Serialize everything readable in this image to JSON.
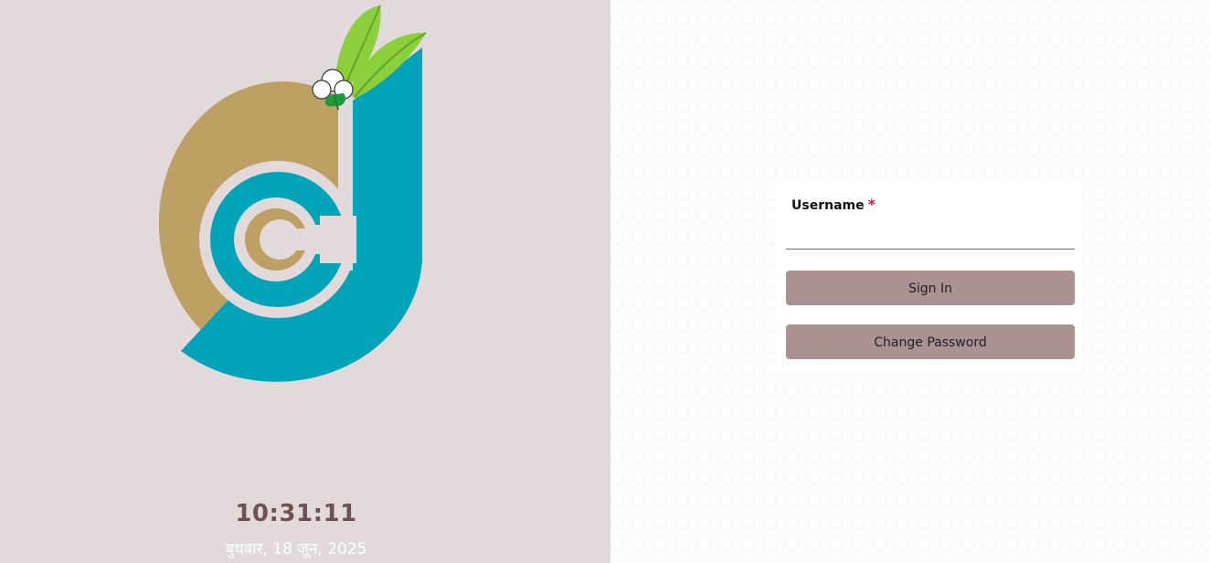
{
  "clock": {
    "time": "10:31:11",
    "date": "बुधवार, 18 जून, 2025"
  },
  "login": {
    "username_label": "Username",
    "required_marker": "*",
    "username_value": "",
    "signin_label": "Sign In",
    "change_password_label": "Change Password"
  },
  "colors": {
    "left_background": "#e2d9db",
    "button": "#ab9191",
    "logo_gold": "#bea065",
    "logo_teal": "#00a3b8",
    "logo_leaf": "#8ccf3c",
    "clock_text": "#6e5152",
    "required": "#c2185b"
  },
  "icons": {
    "logo": "cotton-boll-leaf-logo-icon"
  }
}
